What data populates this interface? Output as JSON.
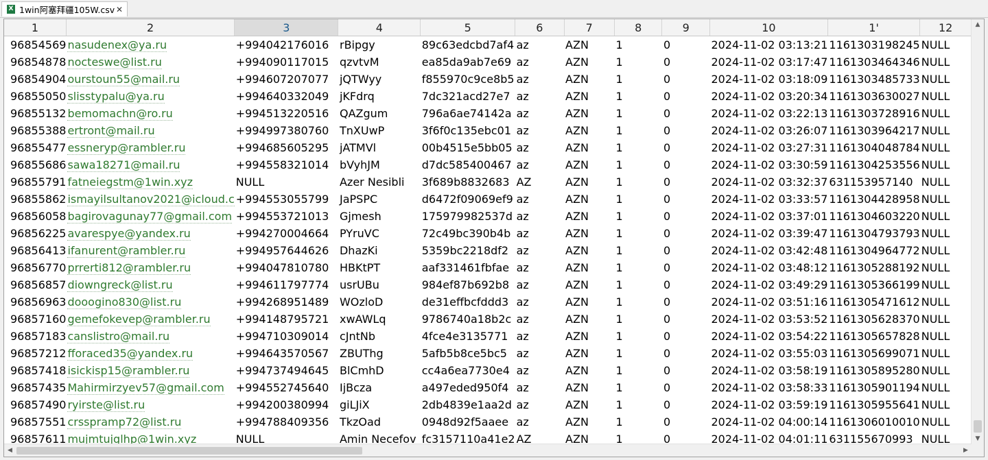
{
  "tab": {
    "title": "1win阿塞拜疆105W.csv",
    "close": "✕",
    "icon": "X"
  },
  "columns": [
    "1",
    "2",
    "3",
    "4",
    "5",
    "6",
    "7",
    "8",
    "9",
    "10",
    "1'",
    "12"
  ],
  "selected_column": "3",
  "rows": [
    [
      "96854569",
      "nasudenex@ya.ru",
      "+994042176016",
      "rBipgy",
      "89c63edcbd7af4",
      "az",
      "AZN",
      "1",
      "0",
      "2024-11-02 03:13:21",
      "1161303198245",
      "NULL"
    ],
    [
      "96854878",
      "nocteswe@list.ru",
      "+994090117015",
      "qzvtvM",
      "ea85da9ab7e69",
      "az",
      "AZN",
      "1",
      "0",
      "2024-11-02 03:17:47",
      "1161303464346",
      "NULL"
    ],
    [
      "96854904",
      "ourstoun55@mail.ru",
      "+994607207077",
      "jQTWyy",
      "f855970c9ce8b5",
      "az",
      "AZN",
      "1",
      "0",
      "2024-11-02 03:18:09",
      "1161303485733",
      "NULL"
    ],
    [
      "96855050",
      "slisstypalu@ya.ru",
      "+994640332049",
      "jKFdrq",
      "7dc321acd27e7",
      "az",
      "AZN",
      "1",
      "0",
      "2024-11-02 03:20:34",
      "1161303630027",
      "NULL"
    ],
    [
      "96855132",
      "bemomachn@ro.ru",
      "+994513220516",
      "QAZgum",
      "796a6ae74142a",
      "az",
      "AZN",
      "1",
      "0",
      "2024-11-02 03:22:13",
      "1161303728916",
      "NULL"
    ],
    [
      "96855388",
      "ertront@mail.ru",
      "+994997380760",
      "TnXUwP",
      "3f6f0c135ebc01",
      "az",
      "AZN",
      "1",
      "0",
      "2024-11-02 03:26:07",
      "1161303964217",
      "NULL"
    ],
    [
      "96855477",
      "essneryp@rambler.ru",
      "+994685605295",
      "jATMVl",
      "00b4515e5bb05",
      "az",
      "AZN",
      "1",
      "0",
      "2024-11-02 03:27:31",
      "1161304048784",
      "NULL"
    ],
    [
      "96855686",
      "sawa18271@mail.ru",
      "+994558321014",
      "bVyhJM",
      "d7dc585400467",
      "az",
      "AZN",
      "1",
      "0",
      "2024-11-02 03:30:59",
      "1161304253556",
      "NULL"
    ],
    [
      "96855791",
      "fatneiegstm@1win.xyz",
      "NULL",
      "Azer Nesibli",
      "3f689b8832683",
      "AZ",
      "AZN",
      "1",
      "0",
      "2024-11-02 03:32:37",
      "631153957140",
      "NULL"
    ],
    [
      "96855862",
      "ismayilsultanov2021@icloud.c",
      "+994553055799",
      "JaPSPC",
      "d6472f09069ef9",
      "az",
      "AZN",
      "1",
      "0",
      "2024-11-02 03:33:57",
      "1161304428958",
      "NULL"
    ],
    [
      "96856058",
      "bagirovagunay77@gmail.com",
      "+994553721013",
      "Gjmesh",
      "175979982537d",
      "az",
      "AZN",
      "1",
      "0",
      "2024-11-02 03:37:01",
      "1161304603220",
      "NULL"
    ],
    [
      "96856225",
      "avarespye@yandex.ru",
      "+994270004664",
      "PYruVC",
      "72c49bc390b4b",
      "az",
      "AZN",
      "1",
      "0",
      "2024-11-02 03:39:47",
      "1161304793793",
      "NULL"
    ],
    [
      "96856413",
      "ifanurent@rambler.ru",
      "+994957644626",
      "DhazKi",
      "5359bc2218df2",
      "az",
      "AZN",
      "1",
      "0",
      "2024-11-02 03:42:48",
      "1161304964772",
      "NULL"
    ],
    [
      "96856770",
      "prrerti812@rambler.ru",
      "+994047810780",
      "HBKtPT",
      "aaf331461fbfae",
      "az",
      "AZN",
      "1",
      "0",
      "2024-11-02 03:48:12",
      "1161305288192",
      "NULL"
    ],
    [
      "96856857",
      "diowngreck@list.ru",
      "+994611797774",
      "usrUBu",
      "984ef87b692b8",
      "az",
      "AZN",
      "1",
      "0",
      "2024-11-02 03:49:29",
      "1161305366199",
      "NULL"
    ],
    [
      "96856963",
      "dooogino830@list.ru",
      "+994268951489",
      "WOzloD",
      "de31effbcfddd3",
      "az",
      "AZN",
      "1",
      "0",
      "2024-11-02 03:51:16",
      "1161305471612",
      "NULL"
    ],
    [
      "96857160",
      "gemefokevep@rambler.ru",
      "+994148795721",
      "xwAWLq",
      "9786740a18b2c",
      "az",
      "AZN",
      "1",
      "0",
      "2024-11-02 03:53:52",
      "1161305628370",
      "NULL"
    ],
    [
      "96857183",
      "canslistro@mail.ru",
      "+994710309014",
      "cJntNb",
      "4fce4e3135771",
      "az",
      "AZN",
      "1",
      "0",
      "2024-11-02 03:54:22",
      "1161305657828",
      "NULL"
    ],
    [
      "96857212",
      "fforaced35@yandex.ru",
      "+994643570567",
      "ZBUThg",
      "5afb5b8ce5bc5",
      "az",
      "AZN",
      "1",
      "0",
      "2024-11-02 03:55:03",
      "1161305699071",
      "NULL"
    ],
    [
      "96857418",
      "isickisp15@rambler.ru",
      "+994737494645",
      "BlCmhD",
      "cc4a6ea7730e4",
      "az",
      "AZN",
      "1",
      "0",
      "2024-11-02 03:58:19",
      "1161305895280",
      "NULL"
    ],
    [
      "96857435",
      "Mahirmirzyev57@gmail.com",
      "+994552745640",
      "IjBcza",
      "a497eded950f4",
      "az",
      "AZN",
      "1",
      "0",
      "2024-11-02 03:58:33",
      "1161305901194",
      "NULL"
    ],
    [
      "96857490",
      "ryirste@list.ru",
      "+994200380994",
      "giLJiX",
      "2db4839e1aa2d",
      "az",
      "AZN",
      "1",
      "0",
      "2024-11-02 03:59:19",
      "1161305955641",
      "NULL"
    ],
    [
      "96857551",
      "crsspramp72@list.ru",
      "+994788409356",
      "TkzOad",
      "0948d92f5aaee",
      "az",
      "AZN",
      "1",
      "0",
      "2024-11-02 04:00:14",
      "1161306010010",
      "NULL"
    ],
    [
      "96857611",
      "mujmtujglhp@1win.xyz",
      "NULL",
      "Amin Necefov",
      "fc3157110a41e2",
      "AZ",
      "AZN",
      "1",
      "0",
      "2024-11-02 04:01:11",
      "631155670993",
      "NULL"
    ]
  ],
  "scrollbar": {
    "up": "▲",
    "down": "▼",
    "left": "◀",
    "right": "▶"
  }
}
